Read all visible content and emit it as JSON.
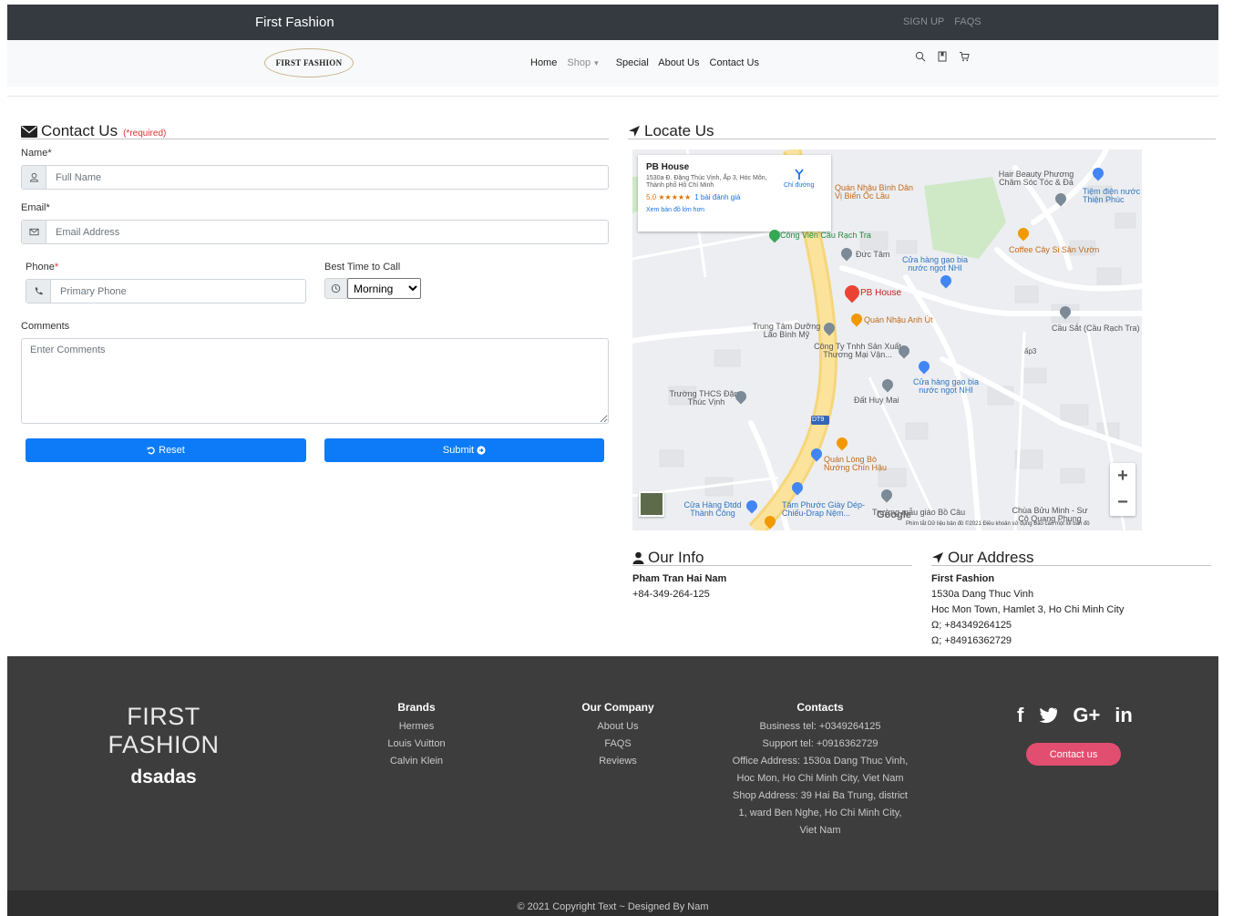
{
  "topbar": {
    "brand": "First Fashion",
    "signup": "SIGN UP",
    "faqs": "FAQS"
  },
  "navbar": {
    "logo_text": "FIRST FASHION",
    "links": [
      "Home",
      "Shop",
      "Special",
      "About Us",
      "Contact Us"
    ],
    "shop_caret": "▾",
    "icons": [
      "search-icon",
      "bookmark-icon",
      "cart-icon"
    ]
  },
  "contact": {
    "title": "Contact Us",
    "required_note": "(*required)",
    "name_label": "Name",
    "name_placeholder": "Full Name",
    "email_label": "Email",
    "email_placeholder": "Email Address",
    "phone_label": "Phone",
    "phone_placeholder": "Primary Phone",
    "time_label": "Best Time to Call",
    "time_selected": "Morning",
    "comments_label": "Comments",
    "comments_placeholder": "Enter Comments",
    "reset_label": "Reset",
    "submit_label": "Submit",
    "required_star": "*"
  },
  "locate": {
    "title": "Locate Us",
    "card": {
      "name": "PB House",
      "address": "1530a Đ. Đặng Thúc Vịnh, Ấp 3, Hóc Môn, Thành phố Hồ Chí Minh",
      "rating": "5,0 ★★★★★",
      "reviews": "1 bài đánh giá",
      "bigger_map": "Xem bản đồ lớn hơn",
      "directions": "Chỉ đường"
    },
    "places": {
      "pb_house": "PB House",
      "quan_nhau_binh": "Quán Nhậu Bình Dân Vị Biển Ốc Lầu",
      "hair_beauty": "Hair Beauty Phương Châm Sóc Tóc & Đá",
      "tiem_dien": "Tiệm điện nước Thiện Phúc",
      "cong_vien": "Công Viên Cầu Rạch Tra",
      "duc_tam": "Đức Tâm",
      "cua_hang_gao_1": "Cửa hàng gạo bia nước ngọt NHI",
      "coffee": "Coffee Cây Si Sân Vườn",
      "quan_nhau_anh_ut": "Quán Nhậu Anh Út",
      "cau_sat": "Cầu Sắt (Cầu Rạch Tra)",
      "trung_tam": "Trung Tâm Dưỡng Lão Bình Mỹ",
      "cong_ty": "Công Ty Tnhh Sản Xuất Thương Mại Vận...",
      "cua_hang_gao_2": "Cửa hàng gạo bia nước ngọt NHI",
      "truong_thcs": "Trường THCS Đặng Thúc Vịnh",
      "dat_huy_mai": "Đất Huy Mai",
      "quan_long_bo": "Quán Lòng Bò Nướng Chín Hậu",
      "cua_hang_dtdd": "Cửa Hàng Đtdd Thành Công",
      "tam_phuoc": "Tâm Phước Giày Dép-Chiếu-Drap Nệm...",
      "truong_mau_giao": "Trường mẫu giáo Bồ Câu",
      "chua_buu_minh": "Chùa Bửu Minh - Sư Cô Quang Phụng",
      "road_dt9": "DT9",
      "road_ap3": "ấp3",
      "google": "Google"
    },
    "map_footer": "Phím tắt   Dữ liệu bản đồ ©2021   Điều khoản sử dụng   Báo cáo một lỗi bản đồ",
    "zoom_in": "+",
    "zoom_out": "−"
  },
  "our_info": {
    "title": "Our Info",
    "name": "Pham Tran Hai Nam",
    "phone": "+84-349-264-125"
  },
  "our_address": {
    "title": "Our Address",
    "company": "First Fashion",
    "line1": "1530a Dang Thuc Vinh",
    "line2": "Hoc Mon Town, Hamlet 3, Ho Chi Minh City",
    "phone1": "Ω; +84349264125",
    "phone2": "Ω; +84916362729"
  },
  "footer": {
    "brand_big": "FIRST FASHION",
    "brand_small": "dsadas",
    "brands": {
      "title": "Brands",
      "items": [
        "Hermes",
        "Louis Vuitton",
        "Calvin Klein"
      ]
    },
    "company": {
      "title": "Our Company",
      "items": [
        "About Us",
        "FAQS",
        "Reviews"
      ]
    },
    "contacts": {
      "title": "Contacts",
      "items": [
        "Business tel: +0349264125",
        "Support tel: +0916362729",
        "Office Address: 1530a Dang Thuc Vinh,",
        "Hoc Mon, Ho Chi Minh City, Viet Nam",
        "Shop Address: 39 Hai Ba Trung, district",
        "1, ward Ben Nghe, Ho Chi Minh City,",
        "Viet Nam"
      ]
    },
    "social": {
      "facebook": "f",
      "googleplus": "G+",
      "linkedin": "in"
    },
    "contact_button": "Contact us",
    "copyright": "© 2021 Copyright Text ~ Designed By Nam"
  }
}
